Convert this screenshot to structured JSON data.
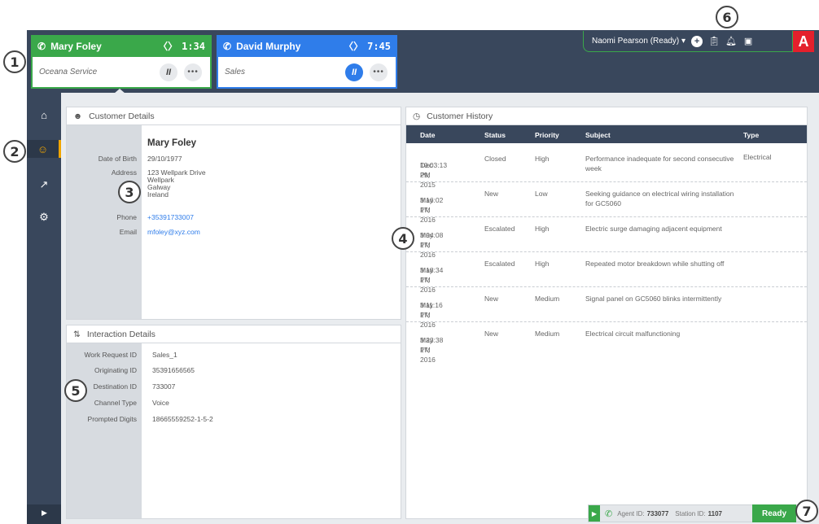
{
  "calls": [
    {
      "name": "Mary Foley",
      "timer": "1:34",
      "queue": "Oceana Service",
      "pause": "II",
      "more": "•••"
    },
    {
      "name": "David Murphy",
      "timer": "7:45",
      "queue": "Sales",
      "pause": "II",
      "more": "•••"
    }
  ],
  "agent": {
    "status_label": "Naomi Pearson (Ready)",
    "caret": "▾",
    "logo": "A"
  },
  "customer": {
    "title": "Customer Details",
    "name": "Mary Foley",
    "fields": [
      {
        "label": "Date of Birth",
        "value": "29/10/1977"
      },
      {
        "label": "Address",
        "value": "123 Wellpark Drive"
      },
      {
        "label": "",
        "value": "Wellpark"
      },
      {
        "label": "",
        "value": "Galway"
      },
      {
        "label": "",
        "value": "Ireland"
      },
      {
        "label": "Phone",
        "value": "+35391733007"
      },
      {
        "label": "Email",
        "value": "mfoley@xyz.com"
      }
    ]
  },
  "interaction": {
    "title": "Interaction Details",
    "fields": [
      {
        "label": "Work Request ID",
        "value": "Sales_1"
      },
      {
        "label": "Originating ID",
        "value": "35391656565"
      },
      {
        "label": "Destination ID",
        "value": "733007"
      },
      {
        "label": "Channel Type",
        "value": "Voice"
      },
      {
        "label": "Prompted Digits",
        "value": "18665559252-1-5-2"
      }
    ]
  },
  "history": {
    "title": "Customer History",
    "columns": [
      "Date",
      "Status",
      "Priority",
      "Subject",
      "Type"
    ],
    "rows": [
      {
        "date": "Dec 29, 2015",
        "time": "10:03:13 PM",
        "status": "Closed",
        "priority": "High",
        "subject": "Performance inadequate for second consecutive week",
        "type": "Electrical"
      },
      {
        "date": "May 17, 2016",
        "time": "3:16:02 PM",
        "status": "New",
        "priority": "Low",
        "subject": "Seeking guidance on electrical wiring installation for GC5060",
        "type": ""
      },
      {
        "date": "May 17, 2016",
        "time": "3:04:08 PM",
        "status": "Escalated",
        "priority": "High",
        "subject": "Electric surge damaging adjacent equipment",
        "type": ""
      },
      {
        "date": "May 17, 2016",
        "time": "3:18:34 PM",
        "status": "Escalated",
        "priority": "High",
        "subject": "Repeated motor breakdown while shutting off",
        "type": ""
      },
      {
        "date": "May 17, 2016",
        "time": "3:11:16 PM",
        "status": "New",
        "priority": "Medium",
        "subject": "Signal panel on GC5060 blinks intermittently",
        "type": ""
      },
      {
        "date": "May 17, 2016",
        "time": "3:23:38 PM",
        "status": "New",
        "priority": "Medium",
        "subject": "Electrical circuit malfunctioning",
        "type": ""
      }
    ]
  },
  "status_bar": {
    "agent_label": "Agent ID:",
    "agent_id": "733077",
    "station_label": "Station ID:",
    "station_id": "1107",
    "ready": "Ready"
  },
  "callouts": [
    "1",
    "2",
    "3",
    "4",
    "5",
    "6",
    "7"
  ],
  "colors": {
    "green": "#3aa84a",
    "blue": "#2f7dea",
    "dark": "#39475c",
    "accent": "#f0a500",
    "logo_red": "#e4202c"
  }
}
